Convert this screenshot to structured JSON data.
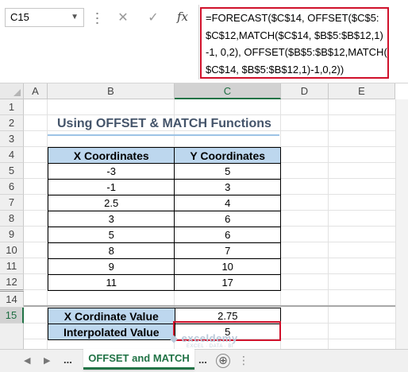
{
  "formula_bar": {
    "name_box": "C15",
    "cancel_icon": "✕",
    "enter_icon": "✓",
    "fx_label": "fx",
    "formula_lines": [
      "=FORECAST($C$14, OFFSET($C$5:",
      "$C$12,MATCH($C$14, $B$5:$B$12,1)",
      "-1, 0,2), OFFSET($B$5:$B$12,MATCH(",
      "$C$14, $B$5:$B$12,1)-1,0,2))"
    ]
  },
  "columns": [
    "A",
    "B",
    "C",
    "D",
    "E"
  ],
  "rows": [
    "1",
    "2",
    "3",
    "4",
    "5",
    "6",
    "7",
    "8",
    "9",
    "10",
    "11",
    "12",
    "14",
    "15"
  ],
  "selected_cell": {
    "column": "C",
    "row": "15"
  },
  "sheet": {
    "title": "Using OFFSET & MATCH Functions",
    "table_headers": [
      "X Coordinates",
      "Y Coordinates"
    ],
    "table_rows": [
      [
        "-3",
        "5"
      ],
      [
        "-1",
        "3"
      ],
      [
        "2.5",
        "4"
      ],
      [
        "3",
        "6"
      ],
      [
        "5",
        "6"
      ],
      [
        "8",
        "7"
      ],
      [
        "9",
        "10"
      ],
      [
        "11",
        "17"
      ]
    ],
    "result_rows": [
      {
        "label": "X Cordinate Value",
        "value": "2.75"
      },
      {
        "label": "Interpolated Value",
        "value": "5"
      }
    ]
  },
  "tabs": {
    "active": "OFFSET and MATCH",
    "ellipsis": "...",
    "add_icon": "⊕"
  },
  "watermark": {
    "name": "exceldemy",
    "tagline": "EXCEL · DATA · BI"
  },
  "colors": {
    "header_fill": "#bdd7ee",
    "highlight_red": "#d0112b",
    "excel_green": "#217346",
    "title_color": "#44546a"
  }
}
